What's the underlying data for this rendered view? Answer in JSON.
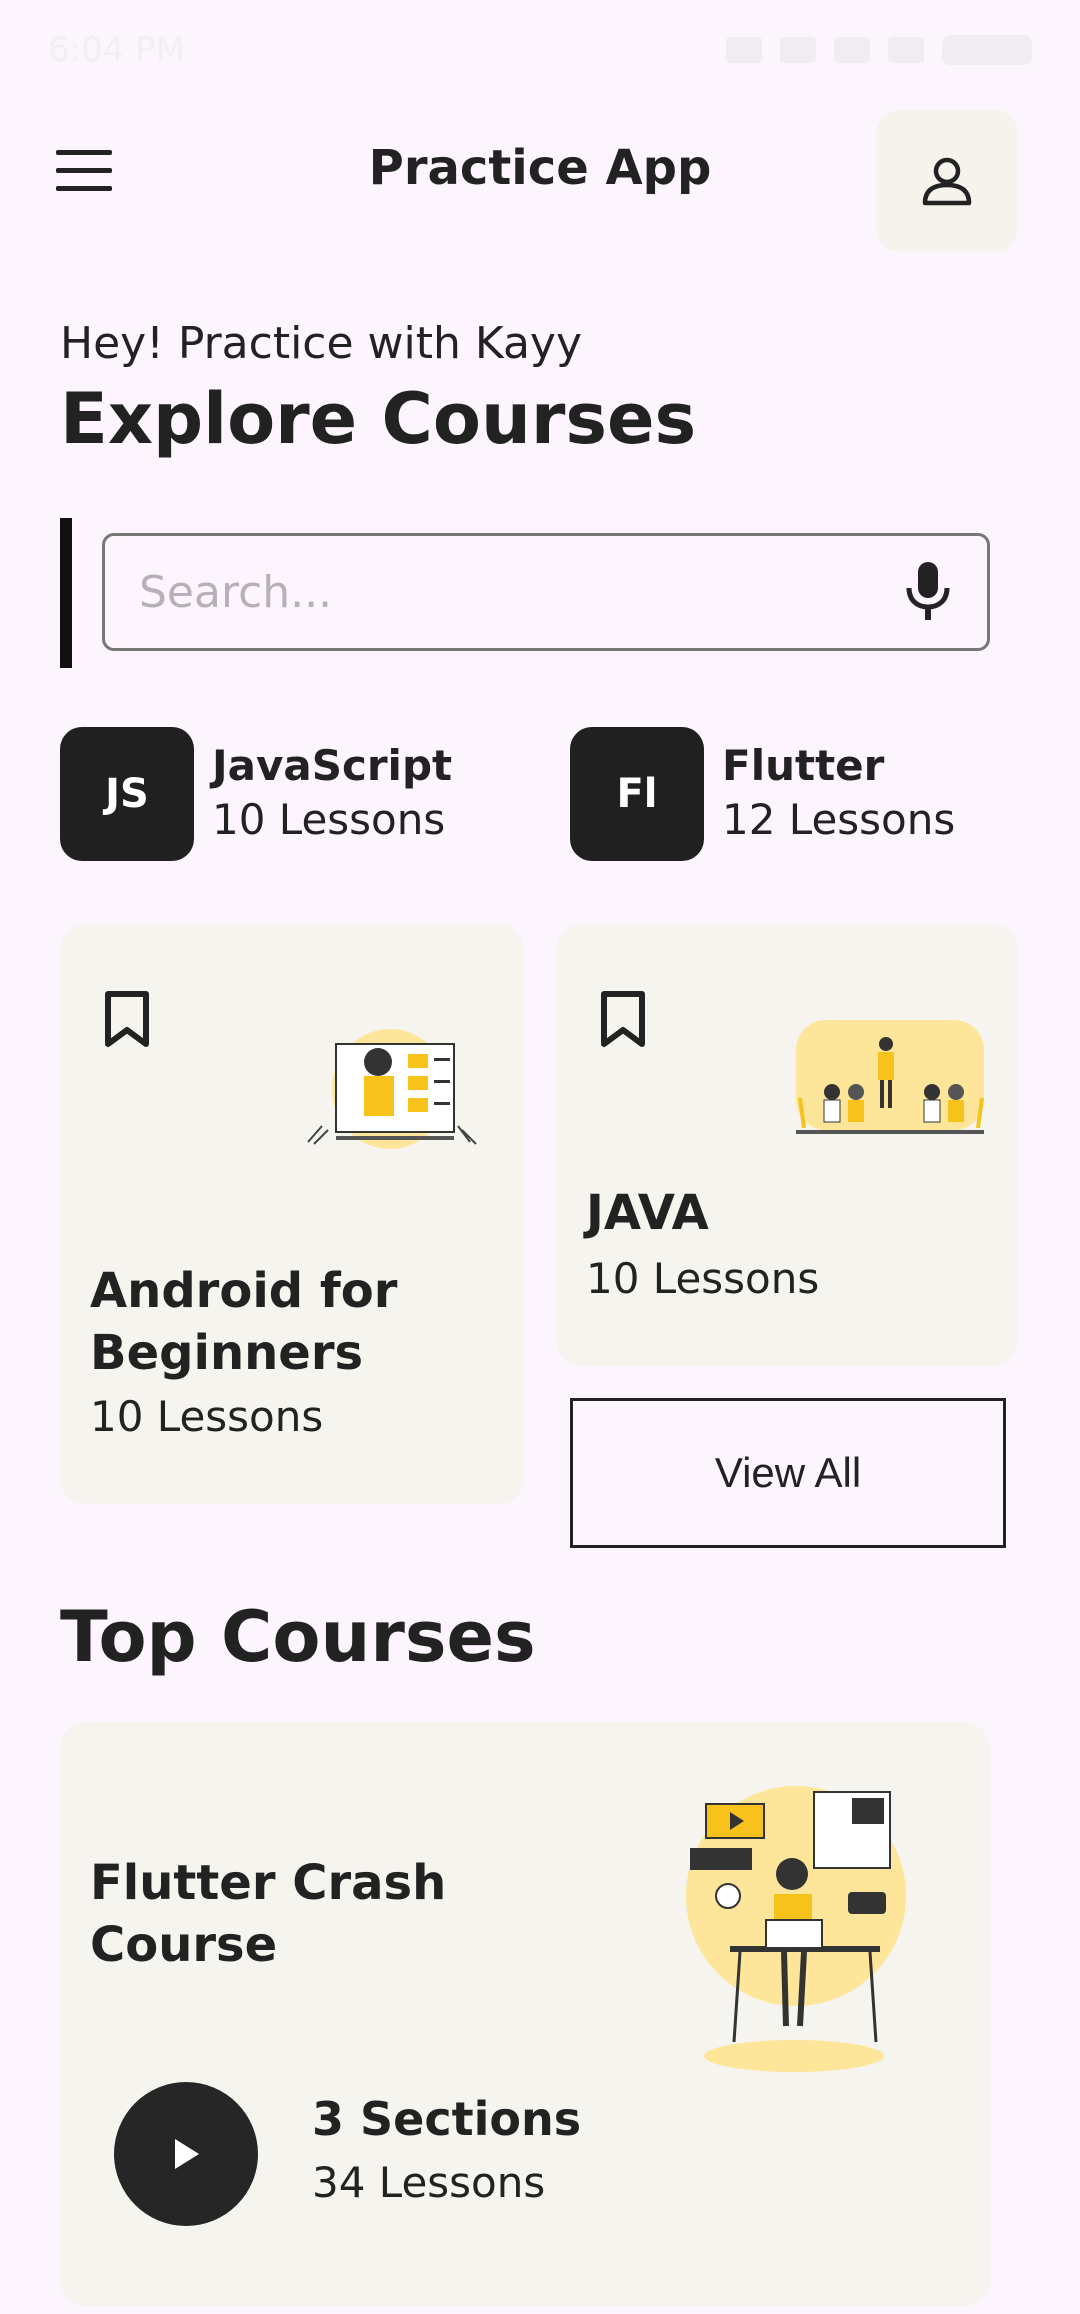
{
  "status_bar": {
    "time": "6:04 PM"
  },
  "app_bar": {
    "title": "Practice App"
  },
  "greeting": "Hey! Practice with Kayy",
  "explore_title": "Explore Courses",
  "search": {
    "placeholder": "Search..."
  },
  "categories": [
    {
      "abbr": "JS",
      "name": "JavaScript",
      "lessons": "10 Lessons"
    },
    {
      "abbr": "Fl",
      "name": "Flutter",
      "lessons": "12 Lessons"
    }
  ],
  "course_cards": [
    {
      "title_line1": "Android for",
      "title_line2": "Beginners",
      "lessons": "10 Lessons"
    },
    {
      "title": "JAVA",
      "lessons": "10 Lessons"
    }
  ],
  "view_all_label": "View All",
  "top_courses_title": "Top Courses",
  "top_course": {
    "title_line1": "Flutter Crash",
    "title_line2": "Course",
    "sections": "3 Sections",
    "lessons": "34 Lessons"
  },
  "colors": {
    "background": "#fcf5fd",
    "card": "#f5f4ef",
    "accent": "#f7c21c",
    "dark": "#202020"
  }
}
